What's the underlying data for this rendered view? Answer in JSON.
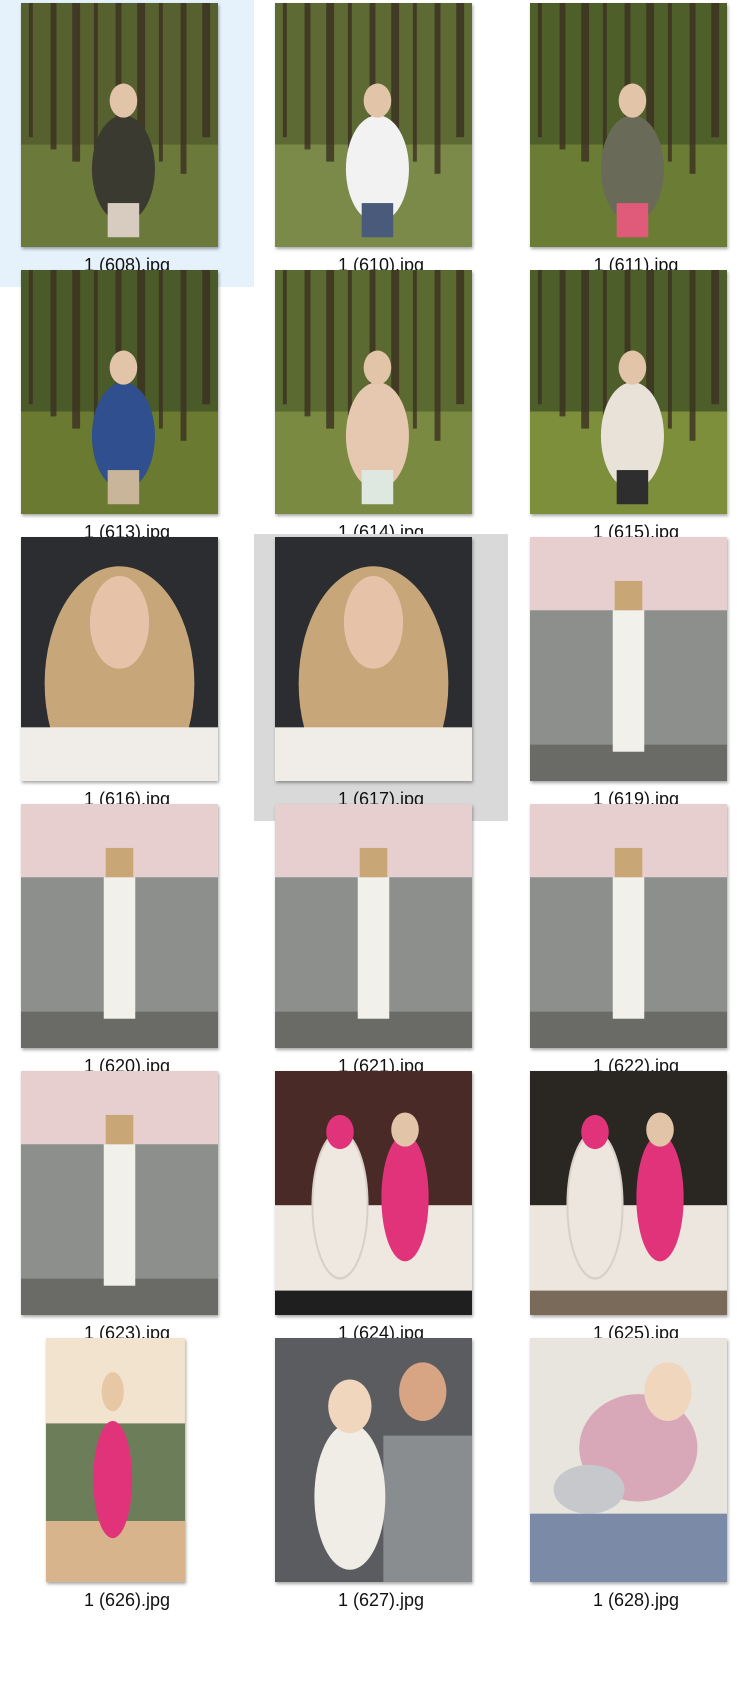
{
  "explorer": {
    "files": [
      {
        "name": "1 (608).jpg",
        "state": "selected",
        "icon": "forest-photo-thumbnail",
        "palette": [
          "#56612f",
          "#6b7a3a",
          "#3a3a30",
          "#d8ccc0"
        ]
      },
      {
        "name": "1 (610).jpg",
        "state": "normal",
        "icon": "forest-photo-thumbnail",
        "palette": [
          "#5d6a33",
          "#7b8a48",
          "#f2f2f2",
          "#4a5a7a"
        ]
      },
      {
        "name": "1 (611).jpg",
        "state": "normal",
        "icon": "forest-photo-thumbnail",
        "palette": [
          "#4f5f2a",
          "#6b7d35",
          "#6a6a58",
          "#e05a7a"
        ]
      },
      {
        "name": "1 (613).jpg",
        "state": "normal",
        "icon": "forest-photo-thumbnail",
        "palette": [
          "#4a5a28",
          "#6a7a30",
          "#2f4f8f",
          "#c9b59a"
        ]
      },
      {
        "name": "1 (614).jpg",
        "state": "normal",
        "icon": "picnic-photo-thumbnail",
        "palette": [
          "#5a6a30",
          "#7a8a40",
          "#e6c8b0",
          "#dfe8e0"
        ]
      },
      {
        "name": "1 (615).jpg",
        "state": "normal",
        "icon": "forest-photo-thumbnail",
        "palette": [
          "#4e5e2a",
          "#7d8f3a",
          "#e9e2d8",
          "#2e2e2e"
        ]
      },
      {
        "name": "1 (616).jpg",
        "state": "normal",
        "icon": "portrait-photo-thumbnail",
        "palette": [
          "#2b2d30",
          "#c7a77a",
          "#e6c3a8",
          "#f0ede8"
        ]
      },
      {
        "name": "1 (617).jpg",
        "state": "hovered",
        "icon": "portrait-photo-thumbnail",
        "palette": [
          "#2b2d30",
          "#c7a77a",
          "#e6c3a8",
          "#f0ede8"
        ]
      },
      {
        "name": "1 (619).jpg",
        "state": "normal",
        "icon": "wall-photo-thumbnail",
        "palette": [
          "#e8cfcf",
          "#8c8f8c",
          "#f2f0ea",
          "#6a6a66"
        ]
      },
      {
        "name": "1 (620).jpg",
        "state": "normal",
        "icon": "wall-photo-thumbnail",
        "palette": [
          "#e8cfcf",
          "#8c8f8c",
          "#f2f0ea",
          "#6a6a66"
        ]
      },
      {
        "name": "1 (621).jpg",
        "state": "normal",
        "icon": "wall-photo-thumbnail",
        "palette": [
          "#e8cfcf",
          "#8c8f8c",
          "#f2f0ea",
          "#6a6a66"
        ]
      },
      {
        "name": "1 (622).jpg",
        "state": "normal",
        "icon": "wall-photo-thumbnail",
        "palette": [
          "#e8cfcf",
          "#8c8f8c",
          "#f2f0ea",
          "#6a6a66"
        ]
      },
      {
        "name": "1 (623).jpg",
        "state": "normal",
        "icon": "wall-photo-thumbnail",
        "palette": [
          "#e8cfcf",
          "#8c8f8c",
          "#f2f0ea",
          "#6a6a66"
        ]
      },
      {
        "name": "1 (624).jpg",
        "state": "normal",
        "icon": "sofa-photo-thumbnail",
        "palette": [
          "#4a2a26",
          "#efe8e0",
          "#e0337a",
          "#1f1f1f"
        ]
      },
      {
        "name": "1 (625).jpg",
        "state": "normal",
        "icon": "terrace-photo-thumbnail",
        "palette": [
          "#2a2622",
          "#ece6de",
          "#e0337a",
          "#7a6a5a"
        ]
      },
      {
        "name": "1 (626).jpg",
        "state": "normal",
        "icon": "sunset-photo-thumbnail",
        "palette": [
          "#f2e3cf",
          "#6c7d5a",
          "#e0337a",
          "#d8b48c"
        ],
        "narrow": true
      },
      {
        "name": "1 (627).jpg",
        "state": "normal",
        "icon": "father-child-photo-thumbnail",
        "palette": [
          "#5a5c60",
          "#8a8d90",
          "#f0ede6",
          "#d7a583"
        ]
      },
      {
        "name": "1 (628).jpg",
        "state": "normal",
        "icon": "baby-photo-thumbnail",
        "palette": [
          "#e8e4de",
          "#d8a8b8",
          "#c6c8cc",
          "#7b8aa6"
        ]
      }
    ]
  }
}
